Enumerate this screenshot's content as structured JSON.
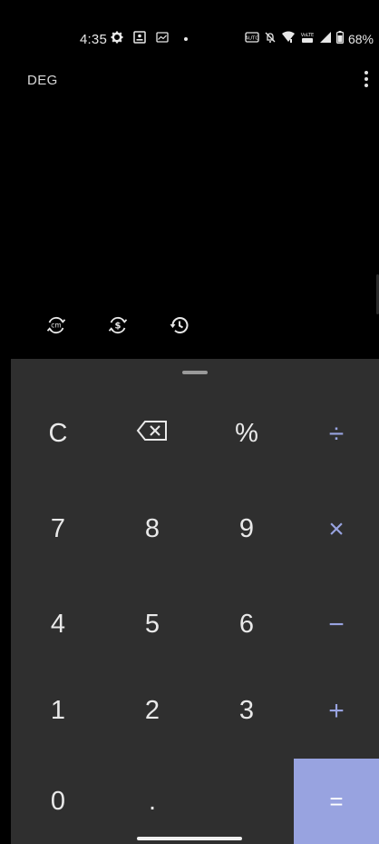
{
  "status_bar": {
    "time": "4:35",
    "battery": "68%",
    "left_icons": [
      "gear-icon",
      "image-card-icon",
      "gallery-icon",
      "dot-icon"
    ],
    "right_icons": [
      "auto-icon",
      "mute-icon",
      "wifi-icon",
      "lte-icon",
      "signal-icon",
      "battery-icon"
    ]
  },
  "header": {
    "mode": "DEG",
    "menu_icon": "more-vert-icon"
  },
  "tools": {
    "unit_icon": "unit-converter-icon",
    "currency_icon": "currency-converter-icon",
    "history_icon": "history-icon"
  },
  "keys": {
    "clear": "C",
    "backspace_icon": "backspace-icon",
    "percent": "%",
    "divide": "÷",
    "seven": "7",
    "eight": "8",
    "nine": "9",
    "multiply": "×",
    "four": "4",
    "five": "5",
    "six": "6",
    "minus": "−",
    "one": "1",
    "two": "2",
    "three": "3",
    "plus": "+",
    "zero": "0",
    "decimal": ".",
    "equals": "="
  },
  "colors": {
    "background": "#000000",
    "keypad": "#2f2f2f",
    "accent": "#98a3e0",
    "text": "#e9e9e9"
  }
}
